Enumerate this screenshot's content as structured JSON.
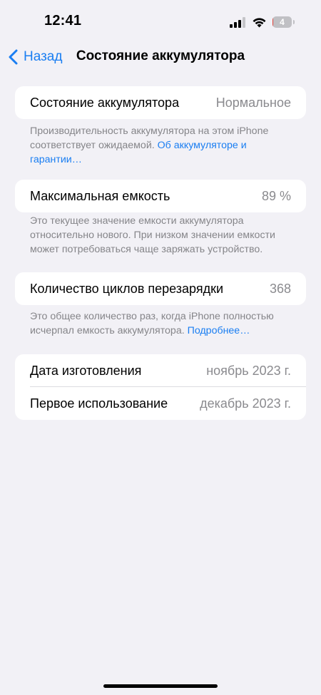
{
  "status_bar": {
    "time": "12:41",
    "battery_level": "4",
    "battery_fraction": 0.04,
    "icons": [
      "signal-icon",
      "wifi-icon",
      "battery-icon"
    ]
  },
  "nav": {
    "back_label": "Назад",
    "title": "Состояние аккумулятора"
  },
  "battery_health": {
    "label": "Состояние аккумулятора",
    "value": "Нормальное",
    "footnote": "Производительность аккумулятора на этом iPhone соответствует ожидаемой.",
    "footnote_link": "Об аккумуляторе и гарантии…"
  },
  "max_capacity": {
    "label": "Максимальная емкость",
    "value": "89 %",
    "footnote": "Это текущее значение емкости аккумулятора относительно нового. При низком значении емкости может потребоваться чаще заряжать устройство."
  },
  "cycle_count": {
    "label": "Количество циклов перезарядки",
    "value": "368",
    "footnote": "Это общее количество раз, когда iPhone полностью исчерпал емкость аккумулятора.",
    "footnote_link": "Подробнее…"
  },
  "dates": {
    "manufacture_label": "Дата изготовления",
    "manufacture_value": "ноябрь 2023 г.",
    "first_use_label": "Первое использование",
    "first_use_value": "декабрь 2023 г."
  },
  "colors": {
    "accent": "#1a7ef2",
    "background": "#f2f1f6",
    "secondary_text": "#8a8a8e",
    "battery_low": "#e0423a"
  }
}
